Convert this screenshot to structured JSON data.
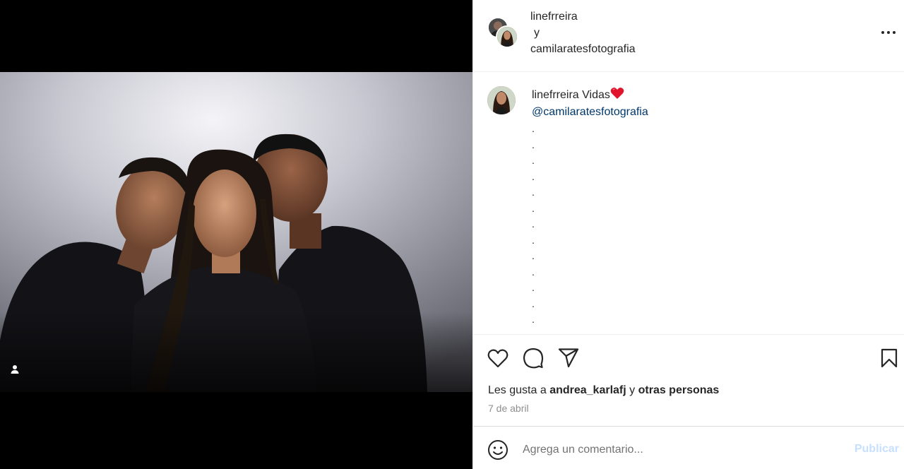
{
  "header": {
    "user1": "linefrreira",
    "conjunction": "y",
    "user2": "camilaratesfotografia",
    "more_icon": "more-horizontal-icon"
  },
  "caption": {
    "username": "linefrreira",
    "text": "Vidas",
    "emoji": "red-heart-emoji",
    "mention": "@camilaratesfotografia",
    "dots": [
      ".",
      ".",
      ".",
      ".",
      ".",
      ".",
      ".",
      ".",
      ".",
      ".",
      ".",
      ".",
      "."
    ]
  },
  "actions": {
    "icons": [
      "heart-icon",
      "comment-icon",
      "share-icon",
      "bookmark-icon"
    ],
    "likes_prefix": "Les gusta a",
    "likes_user": "andrea_karlafj",
    "likes_conj": "y",
    "likes_others": "otras personas",
    "date": "7 de abril"
  },
  "comment": {
    "placeholder": "Agrega un comentario...",
    "publish_label": "Publicar"
  },
  "colors": {
    "link": "#00376b",
    "muted": "#8e8e8e",
    "publish_disabled": "#c7e0fd",
    "heart": "#e0142b"
  }
}
